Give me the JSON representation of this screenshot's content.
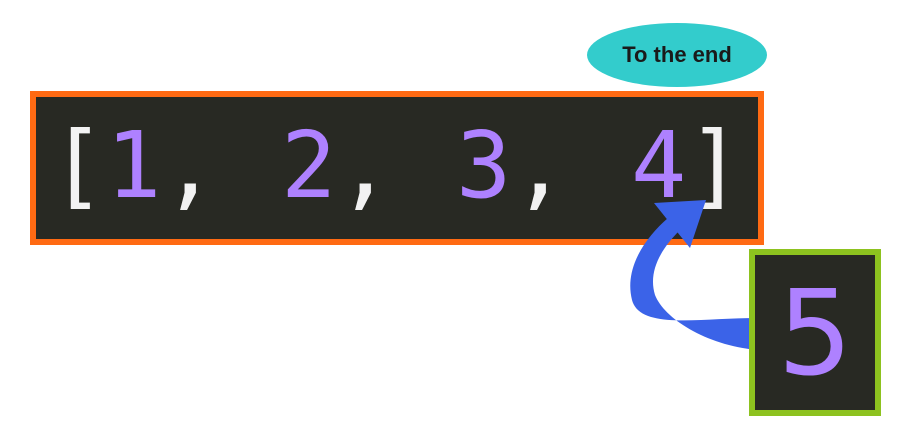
{
  "callout": {
    "text": "To the end"
  },
  "array": {
    "open_bracket": "[",
    "close_bracket": "]",
    "items": [
      "1",
      "2",
      "3",
      "4"
    ],
    "separator": ","
  },
  "new_element": {
    "value": "5"
  },
  "colors": {
    "array_border": "#ff6a13",
    "new_element_border": "#8dc21f",
    "panel_background": "#282923",
    "number_color": "#ae81ff",
    "callout_fill": "#33cccc",
    "arrow_color": "#3b63e8"
  }
}
